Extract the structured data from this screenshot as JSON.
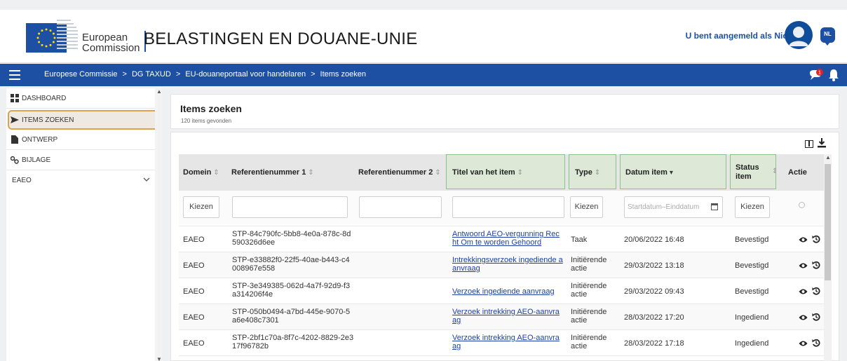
{
  "header": {
    "org_line1": "European",
    "org_line2": "Commission",
    "app_title": "BELASTINGEN EN DOUANE-UNIE",
    "user_text": "U bent aangemeld als Nicolas",
    "language": "NL"
  },
  "breadcrumbs": [
    "Europese Commissie",
    "DG TAXUD",
    "EU-douaneportaal voor handelaren",
    "Items zoeken"
  ],
  "breadcrumb_separator": ">",
  "notifications": {
    "count": "1"
  },
  "sidebar": {
    "items": [
      {
        "label": "DASHBOARD",
        "icon": "dashboard-icon"
      },
      {
        "label": "ITEMS ZOEKEN",
        "icon": "send-icon",
        "active": true
      },
      {
        "label": "ONTWERP",
        "icon": "document-icon"
      },
      {
        "label": "BIJLAGE",
        "icon": "attachment-icon"
      },
      {
        "label": "EAEO",
        "icon": "chevron-down-icon"
      }
    ]
  },
  "main": {
    "title": "Items zoeken",
    "count_text": "120 items gevonden"
  },
  "table": {
    "columns": [
      "Domein",
      "Referentienummer 1",
      "Referentienummer 2",
      "Titel van het item",
      "Type",
      "Datum item",
      "Status item",
      "Actie"
    ],
    "filters": {
      "domain": "Kiezen",
      "type": "Kiezen",
      "date_placeholder": "Startdatum–Einddatum",
      "status": "Kiezen"
    },
    "rows": [
      {
        "domain": "EAEO",
        "ref1_a": "STP-84c790fc-5bb8-4e0a-878c-8d",
        "ref1_b": "590326d6ee",
        "ref2": "",
        "title_a": "Antwoord AEO-vergunning Rec",
        "title_b": "ht Om te worden Gehoord",
        "type_a": "Taak",
        "type_b": "",
        "date": "20/06/2022 16:48",
        "status": "Bevestigd"
      },
      {
        "domain": "EAEO",
        "ref1_a": "STP-e33882f0-22f5-40ae-b443-c4",
        "ref1_b": "008967e558",
        "ref2": "",
        "title_a": "Intrekkingsverzoek ingediende a",
        "title_b": "anvraag",
        "type_a": "Initiërende",
        "type_b": "actie",
        "date": "29/03/2022 13:18",
        "status": "Bevestigd"
      },
      {
        "domain": "EAEO",
        "ref1_a": "STP-3e349385-062d-4a7f-92d9-f3",
        "ref1_b": "a314206f4e",
        "ref2": "",
        "title_a": "Verzoek ingediende aanvraag",
        "title_b": "",
        "type_a": "Initiërende",
        "type_b": "actie",
        "date": "29/03/2022 09:43",
        "status": "Bevestigd"
      },
      {
        "domain": "EAEO",
        "ref1_a": "STP-050b0494-a7bd-445e-9070-5",
        "ref1_b": "a6e408c7301",
        "ref2": "",
        "title_a": "Verzoek intrekking AEO-aanvra",
        "title_b": "ag",
        "type_a": "Initiërende",
        "type_b": "actie",
        "date": "28/03/2022 17:20",
        "status": "Ingediend"
      },
      {
        "domain": "EAEO",
        "ref1_a": "STP-2bf1c70a-8f7c-4202-8829-2e3",
        "ref1_b": "17f96782b",
        "ref2": "",
        "title_a": "Verzoek intrekking AEO-aanvra",
        "title_b": "ag",
        "type_a": "Initiërende",
        "type_b": "actie",
        "date": "28/03/2022 17:18",
        "status": "Ingediend"
      }
    ]
  },
  "colors": {
    "brand_blue": "#1d50a3",
    "active_border": "#e0a14a",
    "highlight_green": "#8cc08c",
    "link": "#1d3fa5",
    "notification_red": "#d9262c"
  }
}
